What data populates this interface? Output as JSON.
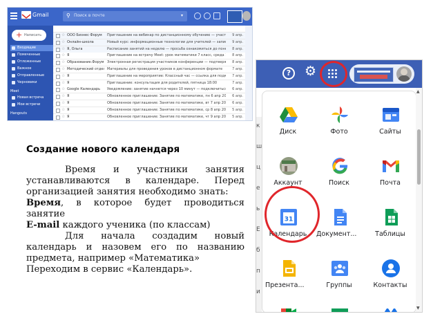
{
  "heading": "Создание нового календаря",
  "body": {
    "p1": "Время и участники занятия устанавливаются в календаре. Перед организацией занятия необходимо знать:",
    "time_bold": "Время",
    "time_rest": ", в которое будет проводиться занятие",
    "email_bold": "E-mail",
    "email_rest": " каждого ученика (по классам)",
    "p2": "Для начала создадим новый календарь и назовем его по названию предмета, например «Математика»",
    "p3": "Переходим в сервис «Календарь»."
  },
  "gmail": {
    "logo_text": "Gmail",
    "search_placeholder": "Поиск в почте",
    "compose_label": "Написать",
    "sidebar": [
      {
        "label": "Входящие"
      },
      {
        "label": "Помеченные"
      },
      {
        "label": "Отложенные"
      },
      {
        "label": "Важное"
      },
      {
        "label": "Отправленные"
      },
      {
        "label": "Черновики"
      }
    ],
    "section_meet": "Meet",
    "meet_items": [
      {
        "label": "Новая встреча"
      },
      {
        "label": "Мои встречи"
      }
    ],
    "section_hangouts": "Hangouts",
    "rows": [
      {
        "sender": "ООО Бизнес Форум",
        "subject": "Приглашение на вебинар по дистанционному обучению — участие бесплатно",
        "date": "9 апр."
      },
      {
        "sender": "Онлайн-школа",
        "subject": "Новый курс: информационные технологии для учителей — запись открыта",
        "date": "9 апр."
      },
      {
        "sender": "Я, Ольга",
        "subject": "Расписание занятий на неделю — просьба ознакомиться до понедельника",
        "date": "8 апр."
      },
      {
        "sender": "Я",
        "subject": "Приглашение на встречу Meet: урок математики 7 класс, среда 10:00",
        "date": "8 апр."
      },
      {
        "sender": "Образование.Форум",
        "subject": "Электронная регистрация участников конференции — подтверждение",
        "date": "8 апр."
      },
      {
        "sender": "Методический отдел",
        "subject": "Материалы для проведения уроков в дистанционном формате",
        "date": "7 апр."
      },
      {
        "sender": "Я",
        "subject": "Приглашение на мероприятие: Классный час — ссылка для подключения",
        "date": "7 апр."
      },
      {
        "sender": "Я",
        "subject": "Приглашение: консультация для родителей, пятница 18:00",
        "date": "7 апр."
      },
      {
        "sender": "Google Календарь",
        "subject": "Уведомление: занятие начнется через 10 минут — подключиться",
        "date": "6 апр."
      },
      {
        "sender": "Я",
        "subject": "Обновленное приглашение: Занятие по математике, пн 6 апр 2020 10:00",
        "date": "6 апр."
      },
      {
        "sender": "Я",
        "subject": "Обновленное приглашение: Занятие по математике, вт 7 апр 2020 10:00",
        "date": "6 апр."
      },
      {
        "sender": "Я",
        "subject": "Обновленное приглашение: Занятие по математике, ср 8 апр 2020 10:00",
        "date": "5 апр."
      },
      {
        "sender": "Я",
        "subject": "Обновленное приглашение: Занятие по математике, чт 9 апр 2020 10:00",
        "date": "5 апр."
      }
    ]
  },
  "apps_panel": {
    "apps": [
      {
        "label": "Диск",
        "icon": "drive-icon"
      },
      {
        "label": "Фото",
        "icon": "photos-icon"
      },
      {
        "label": "Сайты",
        "icon": "sites-icon"
      },
      {
        "label": "Аккаунт",
        "icon": "account-icon"
      },
      {
        "label": "Поиск",
        "icon": "search-icon"
      },
      {
        "label": "Почта",
        "icon": "gmail-icon"
      },
      {
        "label": "Календарь",
        "icon": "calendar-icon"
      },
      {
        "label": "Документ...",
        "icon": "docs-icon"
      },
      {
        "label": "Таблицы",
        "icon": "sheets-icon"
      },
      {
        "label": "Презента...",
        "icon": "slides-icon"
      },
      {
        "label": "Группы",
        "icon": "groups-icon"
      },
      {
        "label": "Контакты",
        "icon": "contacts-icon"
      }
    ],
    "calendar_day": "31",
    "colors": {
      "highlight": "#e0262b",
      "bar": "#3d5fb5"
    }
  }
}
